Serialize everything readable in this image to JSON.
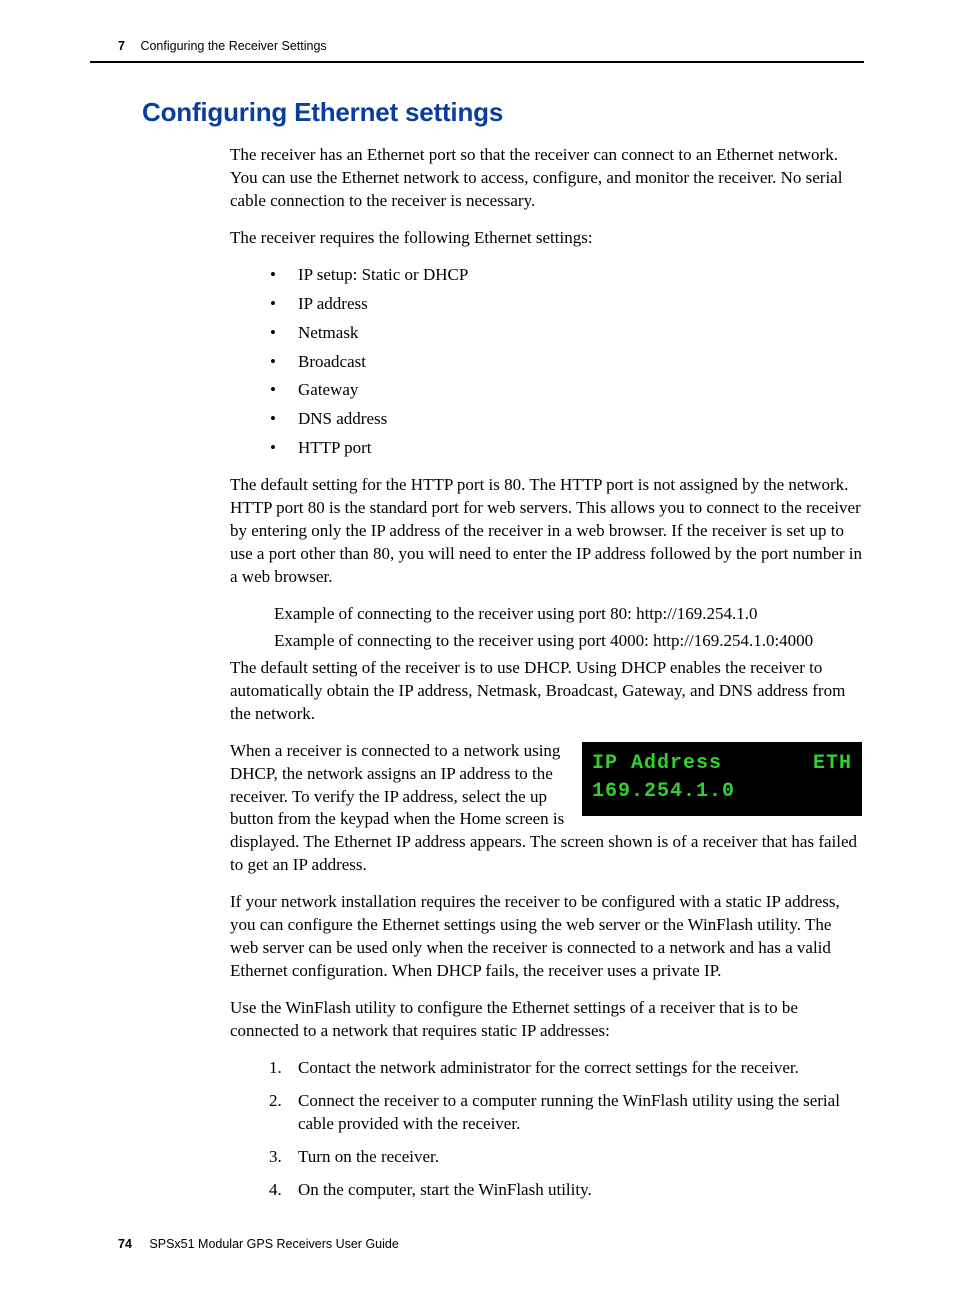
{
  "header": {
    "chapter_number": "7",
    "chapter_title": "Configuring the Receiver Settings"
  },
  "section": {
    "title": "Configuring Ethernet settings"
  },
  "body": {
    "p1": "The receiver has an Ethernet port so that the receiver can connect to an Ethernet network. You can use the Ethernet network to access, configure, and monitor the receiver. No serial cable connection to the receiver is necessary.",
    "p2": "The receiver requires the following Ethernet settings:",
    "bullets": [
      "IP setup: Static or DHCP",
      "IP address",
      "Netmask",
      "Broadcast",
      "Gateway",
      "DNS address",
      "HTTP port"
    ],
    "p3": "The default setting for the HTTP port is 80. The HTTP port is not assigned by the network. HTTP port 80 is the standard port for web servers. This allows you to connect to the receiver by entering only the IP address of the receiver in a web browser. If the receiver is set up to use a port other than 80, you will need to enter the IP address followed by the port number in a web browser.",
    "example80": "Example of connecting to the receiver using port 80: http://169.254.1.0",
    "example4000": "Example of connecting to the receiver using port 4000: http://169.254.1.0:4000",
    "p4": "The default setting of the receiver is to use DHCP. Using DHCP enables the receiver to automatically obtain the IP address, Netmask, Broadcast, Gateway, and DNS address from the network.",
    "p5a": "When a receiver is connected to a network using DHCP, the network assigns an IP address to the receiver. To verify the IP address, select the up button from the keypad when the Home screen is displayed. The Ethernet IP address appears. The screen shown is of a receiver that has failed to get an IP address.",
    "p6": "If your network installation requires the receiver to be configured with a static IP address, you can configure the Ethernet settings using the web server or the WinFlash utility. The web server can be used only when the receiver is connected to a network and has a valid Ethernet configuration. When DHCP fails, the receiver uses a private IP.",
    "p7": "Use the WinFlash utility to configure the Ethernet settings of a receiver that is to be connected to a network that requires static IP addresses:",
    "steps": [
      "Contact the network administrator for the correct settings for the receiver.",
      "Connect the receiver to a computer running the WinFlash utility using the serial cable provided with the receiver.",
      "Turn on the receiver.",
      "On the computer, start the WinFlash utility."
    ]
  },
  "lcd": {
    "line1_left": "IP Address",
    "line1_right": "ETH",
    "line2": "169.254.1.0"
  },
  "footer": {
    "page": "74",
    "guide": "SPSx51 Modular GPS Receivers User Guide"
  }
}
